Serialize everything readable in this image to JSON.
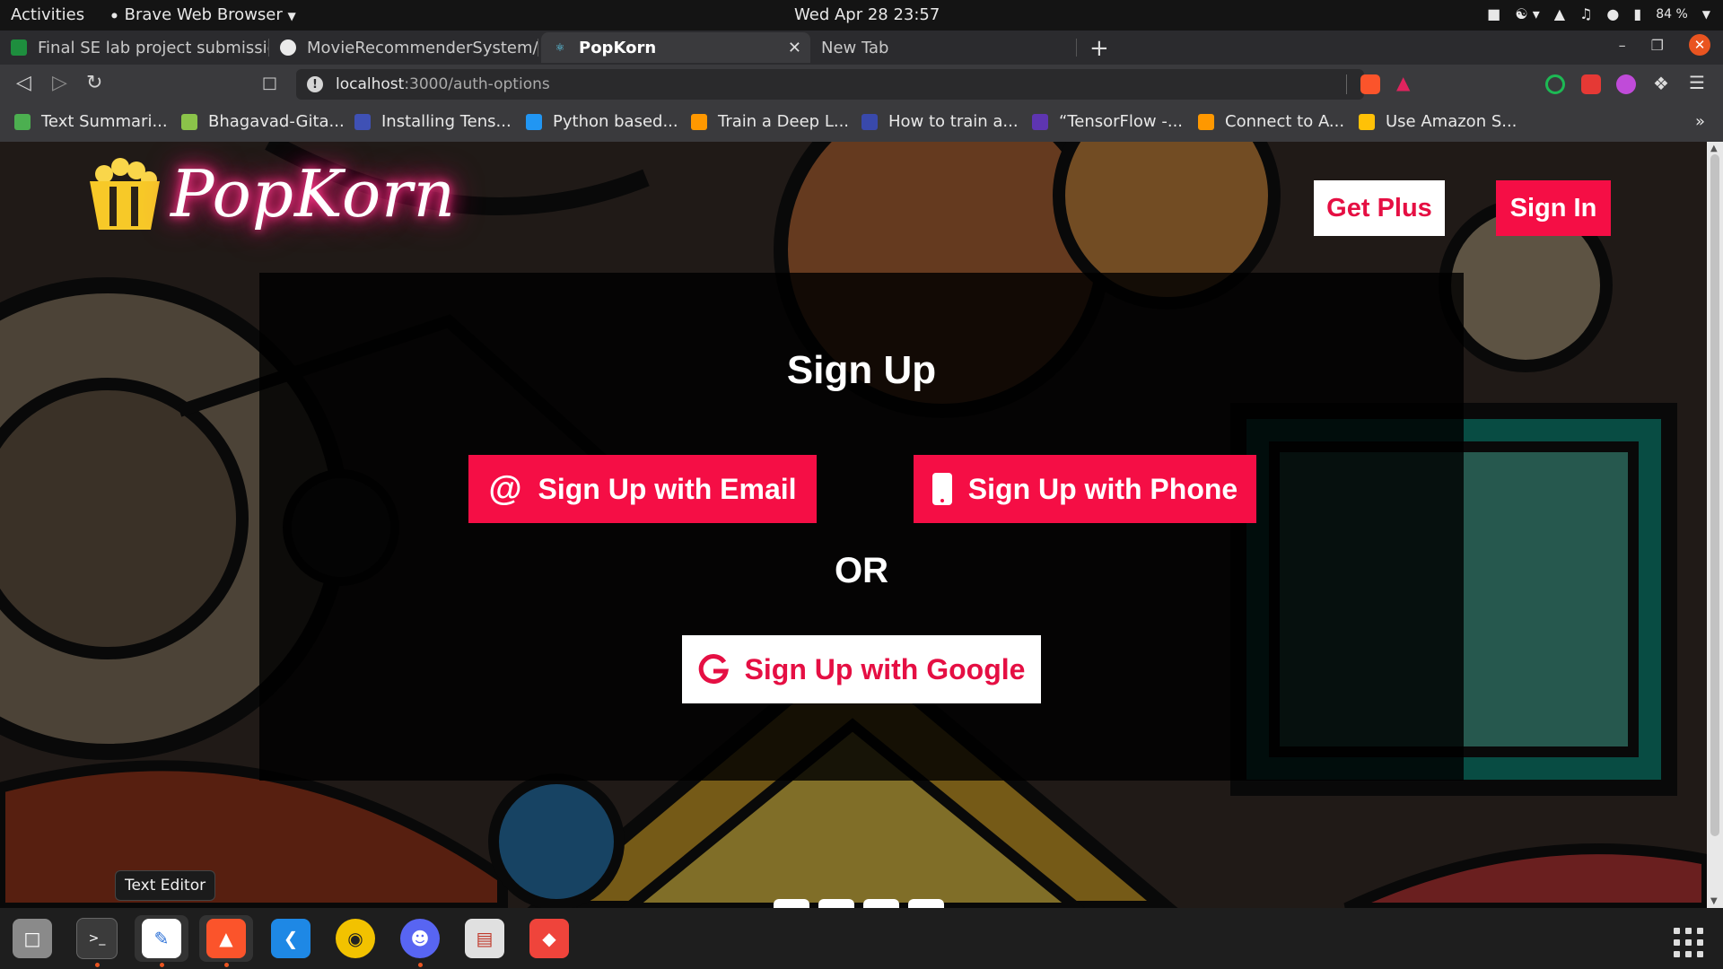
{
  "system_bar": {
    "activities": "Activities",
    "app_menu": "Brave Web Browser",
    "clock": "Wed Apr 28  23:57",
    "battery": "84 %"
  },
  "tabs": [
    {
      "title": "Final SE lab project submissio",
      "active": false
    },
    {
      "title": "MovieRecommenderSystem/M",
      "active": false
    },
    {
      "title": "PopKorn",
      "active": true
    },
    {
      "title": "New Tab",
      "active": false
    }
  ],
  "url": {
    "host": "localhost",
    "path": ":3000/auth-options"
  },
  "bookmarks": [
    {
      "label": "Text Summari...",
      "color": "#4caf50"
    },
    {
      "label": "Bhagavad-Gita...",
      "color": "#8bc34a"
    },
    {
      "label": "Installing Tens...",
      "color": "#3f51b5"
    },
    {
      "label": "Python based...",
      "color": "#2196f3"
    },
    {
      "label": "Train a Deep L...",
      "color": "#ff9800"
    },
    {
      "label": "How to train a...",
      "color": "#3949ab"
    },
    {
      "label": "“TensorFlow -...",
      "color": "#5e35b1"
    },
    {
      "label": "Connect to A...",
      "color": "#ff9800"
    },
    {
      "label": "Use Amazon S...",
      "color": "#ffc107"
    }
  ],
  "bookmarks_more": "»",
  "page": {
    "logo_text": "PopKorn",
    "get_plus": "Get Plus",
    "sign_in": "Sign In",
    "panel_title": "Sign Up",
    "email_button": "Sign Up with Email",
    "phone_button": "Sign Up with Phone",
    "or_text": "OR",
    "google_button": "Sign Up with Google",
    "accent_color": "#f50e45"
  },
  "tooltip": "Text Editor",
  "dock": [
    {
      "name": "files",
      "color": "#8a8a8a"
    },
    {
      "name": "terminal",
      "color": "#3b3b3b"
    },
    {
      "name": "text-editor",
      "color": "#ffffff"
    },
    {
      "name": "brave",
      "color": "#fb542b"
    },
    {
      "name": "vscode",
      "color": "#1e88e5"
    },
    {
      "name": "rhythmbox",
      "color": "#f2c200"
    },
    {
      "name": "discord",
      "color": "#5865f2"
    },
    {
      "name": "document-viewer",
      "color": "#e0e0e0"
    },
    {
      "name": "anydesk",
      "color": "#ef443b"
    }
  ]
}
